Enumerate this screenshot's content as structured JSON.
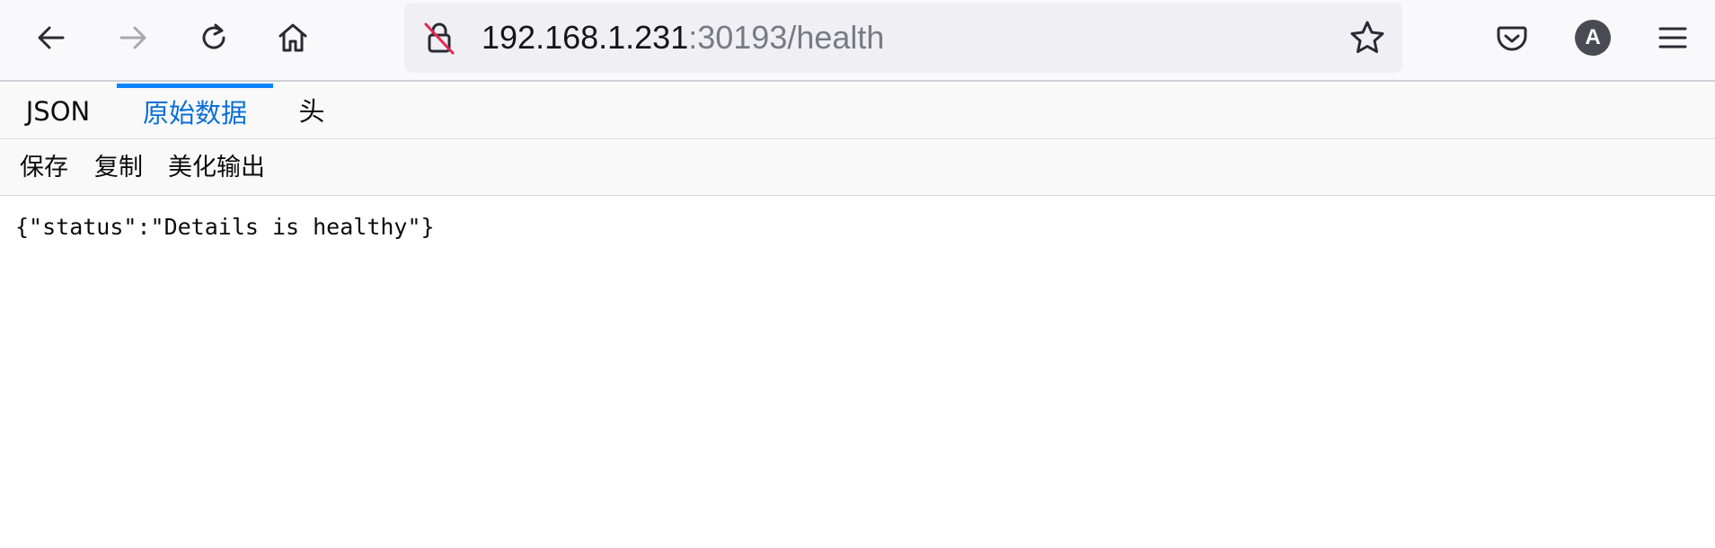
{
  "browser": {
    "url_host": "192.168.1.231",
    "url_rest": ":30193/health",
    "profile_initial": "A",
    "nav": {
      "back_icon": "arrow-left-icon",
      "forward_icon": "arrow-right-icon",
      "reload_icon": "reload-icon",
      "home_icon": "home-icon"
    },
    "security_icon": "insecure-lock-icon",
    "bookmark_icon": "star-icon",
    "pocket_icon": "pocket-icon",
    "menu_icon": "hamburger-menu-icon"
  },
  "viewer": {
    "tabs": [
      {
        "label": "JSON",
        "selected": false
      },
      {
        "label": "原始数据",
        "selected": true
      },
      {
        "label": "头",
        "selected": false
      }
    ],
    "actions": [
      {
        "label": "保存"
      },
      {
        "label": "复制"
      },
      {
        "label": "美化输出"
      }
    ],
    "raw_text": "{\"status\":\"Details is healthy\"}"
  },
  "colors": {
    "accent": "#0a84ff",
    "selected_tab_text": "#0a6fd8",
    "toolbar_bg": "#f9f9fb",
    "urlbar_bg": "#f0f0f4"
  }
}
